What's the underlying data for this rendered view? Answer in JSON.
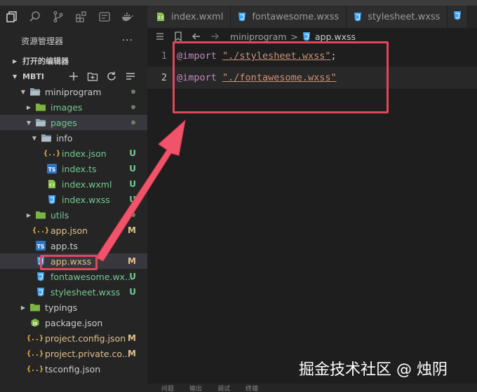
{
  "tabs": [
    {
      "label": "index.wxml",
      "icon": "wxml-icon"
    },
    {
      "label": "fontawesome.wxss",
      "icon": "css-icon"
    },
    {
      "label": "stylesheet.wxss",
      "icon": "css-icon"
    }
  ],
  "explorer": {
    "title": "资源管理器",
    "more": "···"
  },
  "sections": {
    "open_editors": "打开的编辑器",
    "project": "MBTI"
  },
  "tree": [
    {
      "label": "miniprogram",
      "depth": 0,
      "type": "folder-open",
      "status": "dot"
    },
    {
      "label": "images",
      "depth": 1,
      "type": "folder-closed",
      "status": "dot"
    },
    {
      "label": "pages",
      "depth": 1,
      "type": "folder-open",
      "status": "dot"
    },
    {
      "label": "info",
      "depth": 2,
      "type": "folder-open",
      "status": ""
    },
    {
      "label": "index.json",
      "depth": 3,
      "type": "json",
      "status": "U"
    },
    {
      "label": "index.ts",
      "depth": 3,
      "type": "ts",
      "status": "U"
    },
    {
      "label": "index.wxml",
      "depth": 3,
      "type": "wxml",
      "status": "U"
    },
    {
      "label": "index.wxss",
      "depth": 3,
      "type": "css",
      "status": "U"
    },
    {
      "label": "utils",
      "depth": 1,
      "type": "folder-closed",
      "status": "dot"
    },
    {
      "label": "app.json",
      "depth": 1,
      "type": "json",
      "status": "M"
    },
    {
      "label": "app.ts",
      "depth": 1,
      "type": "ts",
      "status": ""
    },
    {
      "label": "app.wxss",
      "depth": 1,
      "type": "css",
      "status": "M"
    },
    {
      "label": "fontawesome.wx...",
      "depth": 1,
      "type": "css",
      "status": "U"
    },
    {
      "label": "stylesheet.wxss",
      "depth": 1,
      "type": "css",
      "status": "U"
    },
    {
      "label": "typings",
      "depth": 0,
      "type": "folder-closed",
      "status": ""
    },
    {
      "label": "package.json",
      "depth": 0,
      "type": "pkg",
      "status": ""
    },
    {
      "label": "project.config.json",
      "depth": 0,
      "type": "json",
      "status": "M"
    },
    {
      "label": "project.private.co...",
      "depth": 0,
      "type": "json",
      "status": "M"
    },
    {
      "label": "tsconfig.json",
      "depth": 0,
      "type": "json",
      "status": ""
    }
  ],
  "breadcrumb": {
    "folder": "miniprogram",
    "sep": ">",
    "file": "app.wxss"
  },
  "editor": {
    "lines": [
      {
        "num": "1",
        "keyword": "@import",
        "value": "\"./stylesheet.wxss\"",
        "end": ";"
      },
      {
        "num": "2",
        "keyword": "@import",
        "value": "\"./fontawesome.wxss\"",
        "end": ""
      }
    ]
  },
  "watermark": "掘金技术社区 @ 烛阴",
  "panel_tabs": [
    "问题",
    "输出",
    "调试",
    "终端"
  ],
  "colors": {
    "annotation": "#e0475b",
    "modified": "#e2c08d",
    "untracked": "#73c991"
  }
}
